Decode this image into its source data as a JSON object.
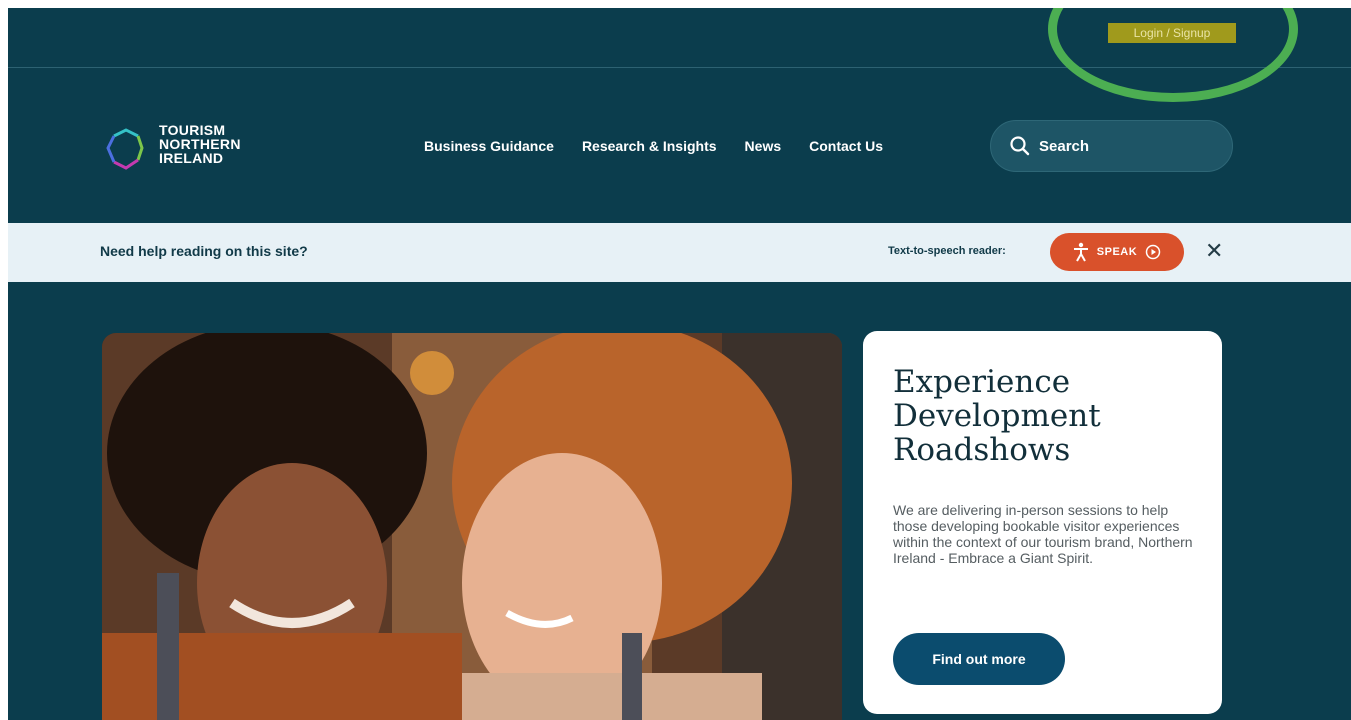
{
  "utility": {
    "login_label": "Login / Signup"
  },
  "header": {
    "logo_lines": [
      "TOURISM",
      "NORTHERN",
      "IRELAND"
    ],
    "nav": [
      "Business Guidance",
      "Research & Insights",
      "News",
      "Contact Us"
    ],
    "search_label": "Search"
  },
  "accessibility_bar": {
    "prompt": "Need help reading on this site?",
    "tts_label": "Text-to-speech reader:",
    "speak_label": "SPEAK",
    "close_glyph": "✕"
  },
  "hero": {
    "title": "Experience Development Roadshows",
    "body": "We are delivering in-person sessions to help those developing bookable visitor experiences within the context of our tourism brand, Northern Ireland - Embrace a Giant Spirit.",
    "button_label": "Find out more"
  },
  "colors": {
    "background": "#0b3d4d",
    "login_highlight": "#a09a1c",
    "annotation_circle": "#4cae52",
    "speak_button": "#d9512b",
    "card_button": "#0b4c6e"
  },
  "icons": [
    "logo-mark-icon",
    "search-icon",
    "accessibility-person-icon",
    "play-circle-icon",
    "close-icon"
  ]
}
